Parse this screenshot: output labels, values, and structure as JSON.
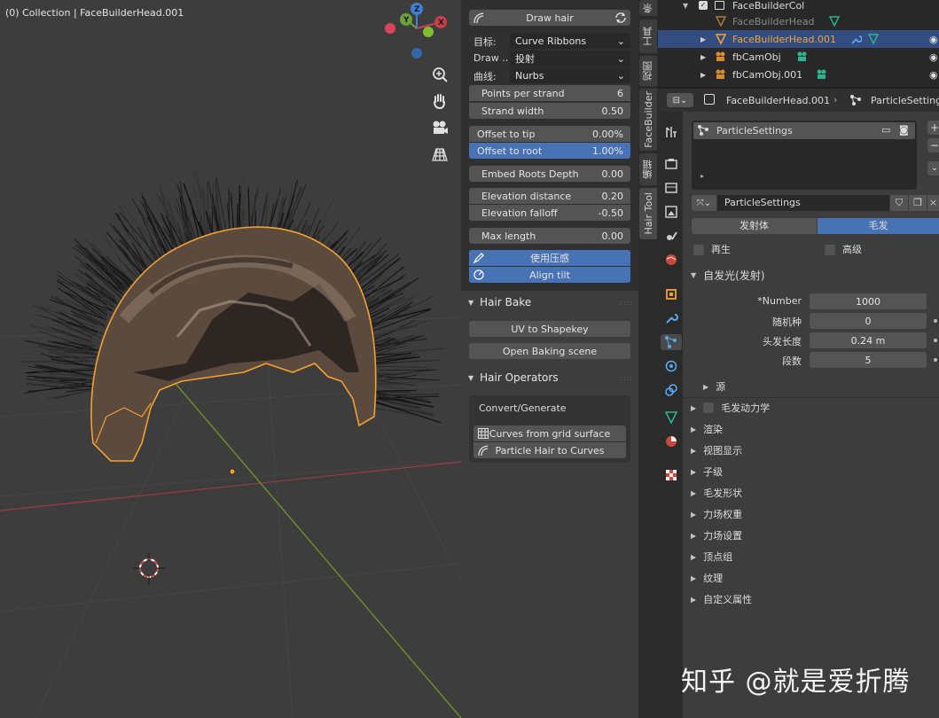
{
  "viewport": {
    "title": "(0) Collection | FaceBuilderHead.001",
    "gizmo": {
      "x": "X",
      "y": "Y",
      "z": "Z"
    }
  },
  "npanel": {
    "draw_hair": "Draw hair",
    "target_label": "目标:",
    "target_value": "Curve Ribbons",
    "draw_label": "Draw ..",
    "draw_value": "投射",
    "curve_label": "曲线:",
    "curve_value": "Nurbs",
    "points_per_strand": {
      "label": "Points per strand",
      "value": "6"
    },
    "strand_width": {
      "label": "Strand width",
      "value": "0.50"
    },
    "offset_to_tip": {
      "label": "Offset to tip",
      "value": "0.00%"
    },
    "offset_to_root": {
      "label": "Offset to root",
      "value": "1.00%"
    },
    "embed_roots_depth": {
      "label": "Embed Roots Depth",
      "value": "0.00"
    },
    "elevation_distance": {
      "label": "Elevation distance",
      "value": "0.20"
    },
    "elevation_falloff": {
      "label": "Elevation falloff",
      "value": "-0.50"
    },
    "max_length": {
      "label": "Max length",
      "value": "0.00"
    },
    "use_pressure": "使用压感",
    "align_tilt": "Align tilt",
    "hair_bake": {
      "title": "Hair Bake",
      "uv_to_shapekey": "UV to Shapekey",
      "open_baking_scene": "Open Baking scene"
    },
    "hair_operators": {
      "title": "Hair Operators",
      "convert_generate": "Convert/Generate",
      "curves_from_grid": "Curves from grid surface",
      "particle_hair_to_curves": "Particle Hair to Curves"
    }
  },
  "tabs": [
    {
      "label": "条"
    },
    {
      "label": "工具"
    },
    {
      "label": "视图"
    },
    {
      "label": "FaceBuilder"
    },
    {
      "label": "编辑"
    },
    {
      "label": "Hair Tool"
    }
  ],
  "outliner": {
    "rows": [
      {
        "name": "FaceBuilderCol"
      },
      {
        "name": "FaceBuilderHead"
      },
      {
        "name": "FaceBuilderHead.001"
      },
      {
        "name": "fbCamObj"
      },
      {
        "name": "fbCamObj.001"
      }
    ]
  },
  "properties": {
    "object_name": "FaceBuilderHead.001",
    "settings_name": "ParticleSettings",
    "list_item": "ParticleSettings",
    "datablock_name": "ParticleSettings",
    "emitter_tab": "发射体",
    "hair_tab": "毛发",
    "regrow_label": "再生",
    "advanced_label": "高级",
    "emission_section": "自发光(发射)",
    "fields": {
      "number": {
        "label": "*Number",
        "value": "1000"
      },
      "seed": {
        "label": "随机种",
        "value": "0"
      },
      "hair_length": {
        "label": "头发长度",
        "value": "0.24 m"
      },
      "segments": {
        "label": "段数",
        "value": "5"
      }
    },
    "source_section": "源",
    "hair_dynamics": "毛发动力学",
    "sections": [
      "渲染",
      "视图显示",
      "子级",
      "毛发形状",
      "力场权重",
      "力场设置",
      "顶点组",
      "纹理",
      "自定义属性"
    ]
  },
  "watermark": "知乎 @就是爱折腾",
  "colors": {
    "accent_blue": "#4772b3",
    "selection_orange": "#f5a131",
    "axis_red": "#c93f4f",
    "axis_green": "#7a9a2e"
  }
}
